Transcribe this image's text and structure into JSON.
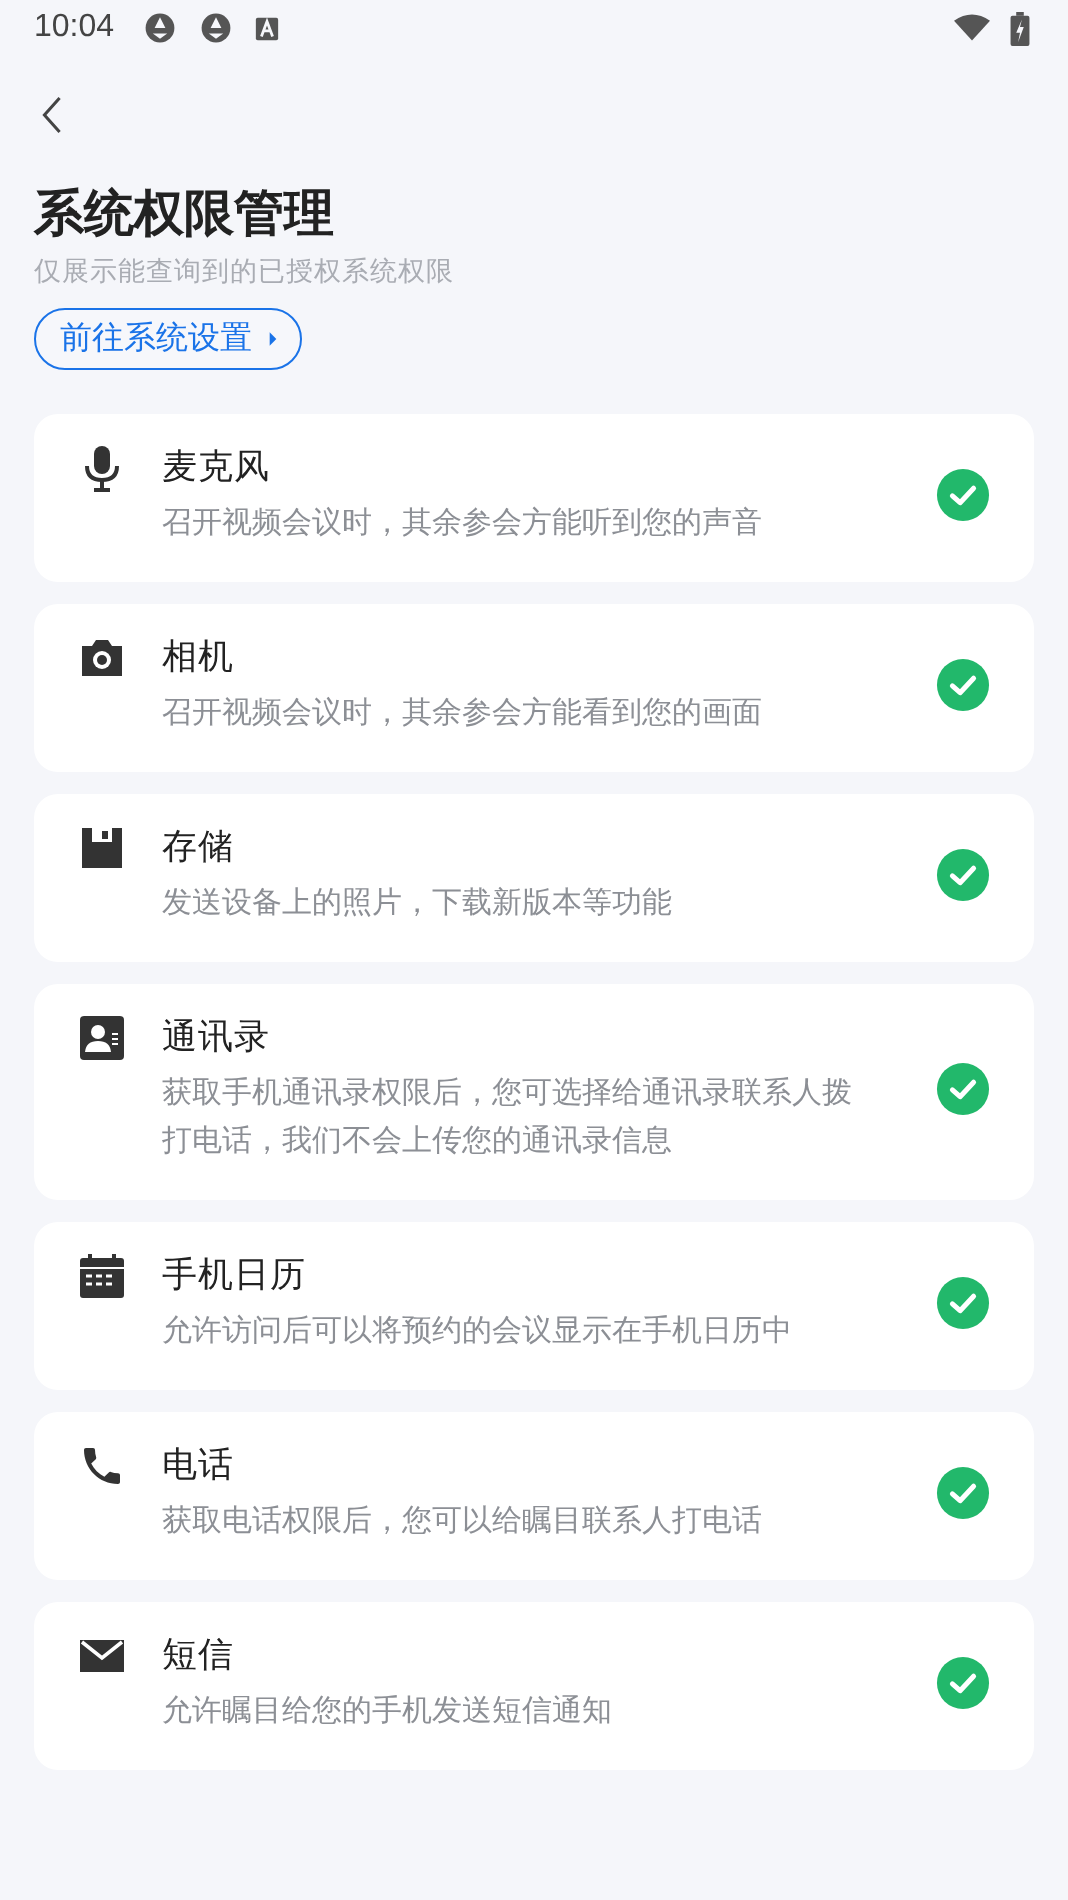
{
  "status_bar": {
    "time": "10:04"
  },
  "header": {
    "title": "系统权限管理",
    "subtitle": "仅展示能查询到的已授权系统权限",
    "settings_link": "前往系统设置"
  },
  "permissions": [
    {
      "kind": "microphone",
      "name": "麦克风",
      "description": "召开视频会议时，其余参会方能听到您的声音",
      "granted": true
    },
    {
      "kind": "camera",
      "name": "相机",
      "description": "召开视频会议时，其余参会方能看到您的画面",
      "granted": true
    },
    {
      "kind": "storage",
      "name": "存储",
      "description": "发送设备上的照片，下载新版本等功能",
      "granted": true
    },
    {
      "kind": "contacts",
      "name": "通讯录",
      "description": "获取手机通讯录权限后，您可选择给通讯录联系人拨打电话，我们不会上传您的通讯录信息",
      "granted": true
    },
    {
      "kind": "calendar",
      "name": "手机日历",
      "description": "允许访问后可以将预约的会议显示在手机日历中",
      "granted": true
    },
    {
      "kind": "phone",
      "name": "电话",
      "description": "获取电话权限后，您可以给瞩目联系人打电话",
      "granted": true
    },
    {
      "kind": "sms",
      "name": "短信",
      "description": "允许瞩目给您的手机发送短信通知",
      "granted": true
    }
  ]
}
